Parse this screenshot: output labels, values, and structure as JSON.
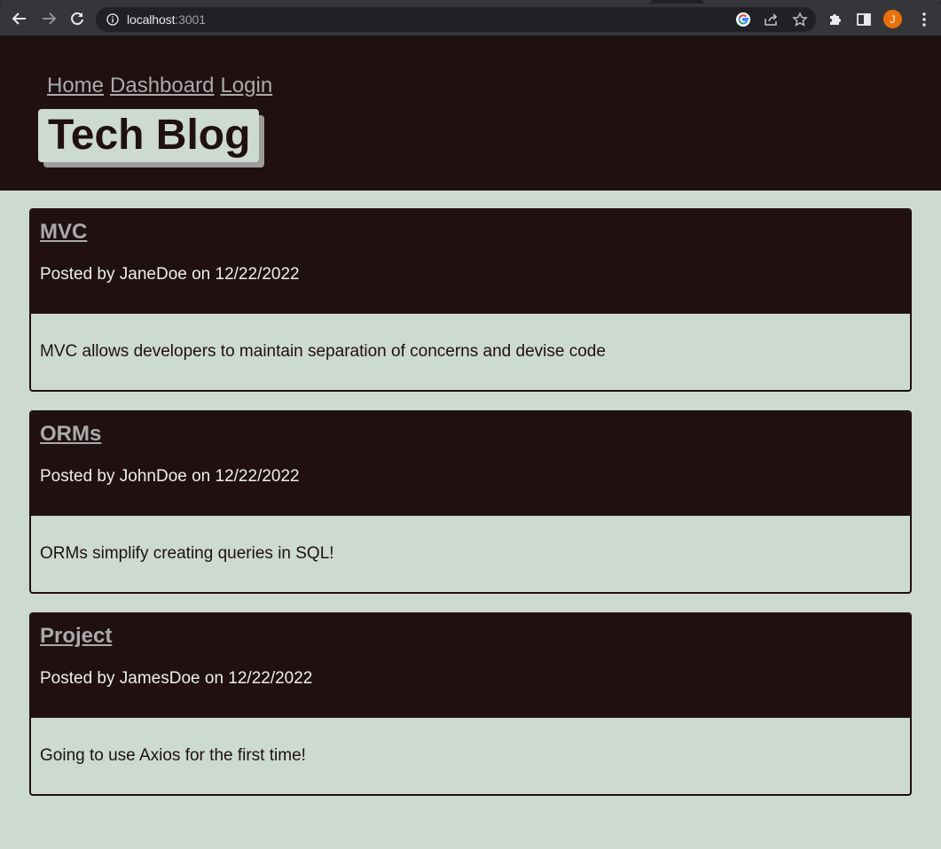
{
  "browser": {
    "url_host": "localhost",
    "url_port": ":3001",
    "avatar_letter": "J",
    "icons": [
      "back-icon",
      "forward-icon",
      "reload-icon",
      "info-icon",
      "google-icon",
      "share-icon",
      "star-icon",
      "extensions-icon",
      "side-panel-icon",
      "menu-icon"
    ]
  },
  "nav": {
    "home": "Home",
    "dashboard": "Dashboard",
    "login": "Login"
  },
  "site_title": "Tech Blog",
  "posts": [
    {
      "title": "MVC",
      "meta": "Posted by JaneDoe on 12/22/2022",
      "body": "MVC allows developers to maintain separation of concerns and devise code"
    },
    {
      "title": "ORMs",
      "meta": "Posted by JohnDoe on 12/22/2022",
      "body": "ORMs simplify creating queries in SQL!"
    },
    {
      "title": "Project",
      "meta": "Posted by JamesDoe on 12/22/2022",
      "body": "Going to use Axios for the first time!"
    }
  ],
  "colors": {
    "dark": "#201011",
    "light": "#ccdad1",
    "link": "#aaaaaa",
    "chrome": "#35363a"
  }
}
